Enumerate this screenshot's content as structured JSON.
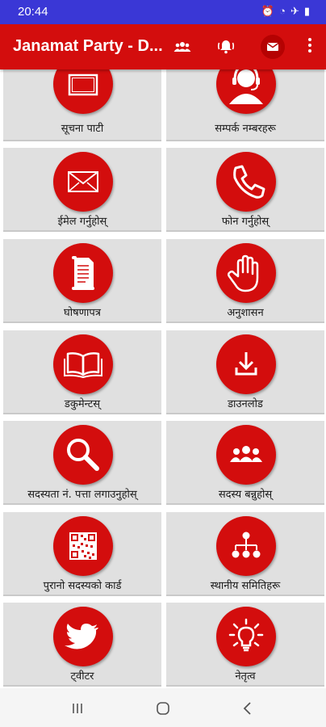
{
  "status": {
    "time": "20:44"
  },
  "app_bar": {
    "title": "Janamat Party - D..."
  },
  "tiles": [
    {
      "label": "सूचना पाटी",
      "icon": "notice-board-icon"
    },
    {
      "label": "सम्पर्क नम्बरहरू",
      "icon": "headset-support-icon"
    },
    {
      "label": "ईमेल गर्नुहोस्",
      "icon": "envelope-icon"
    },
    {
      "label": "फोन गर्नुहोस्",
      "icon": "phone-icon"
    },
    {
      "label": "घोषणापत्र",
      "icon": "scroll-document-icon"
    },
    {
      "label": "अनुशासन",
      "icon": "raised-hand-icon"
    },
    {
      "label": "डकुमेन्टस्",
      "icon": "open-book-icon"
    },
    {
      "label": "डाउनलोड",
      "icon": "download-icon"
    },
    {
      "label": "सदस्यता नं. पत्ता लगाउनुहोस्",
      "icon": "magnifier-icon"
    },
    {
      "label": "सदस्य बन्नुहोस्",
      "icon": "group-users-icon"
    },
    {
      "label": "पुरानो सदस्यको कार्ड",
      "icon": "qr-code-icon"
    },
    {
      "label": "स्थानीय समितिहरू",
      "icon": "hierarchy-icon"
    },
    {
      "label": "ट्वीटर",
      "icon": "twitter-bird-icon"
    },
    {
      "label": "नेतृत्व",
      "icon": "light-bulb-icon"
    }
  ],
  "colors": {
    "primary": "#d30d0d",
    "status_bar": "#3a37d6",
    "tile_bg": "#e0e0e0"
  }
}
